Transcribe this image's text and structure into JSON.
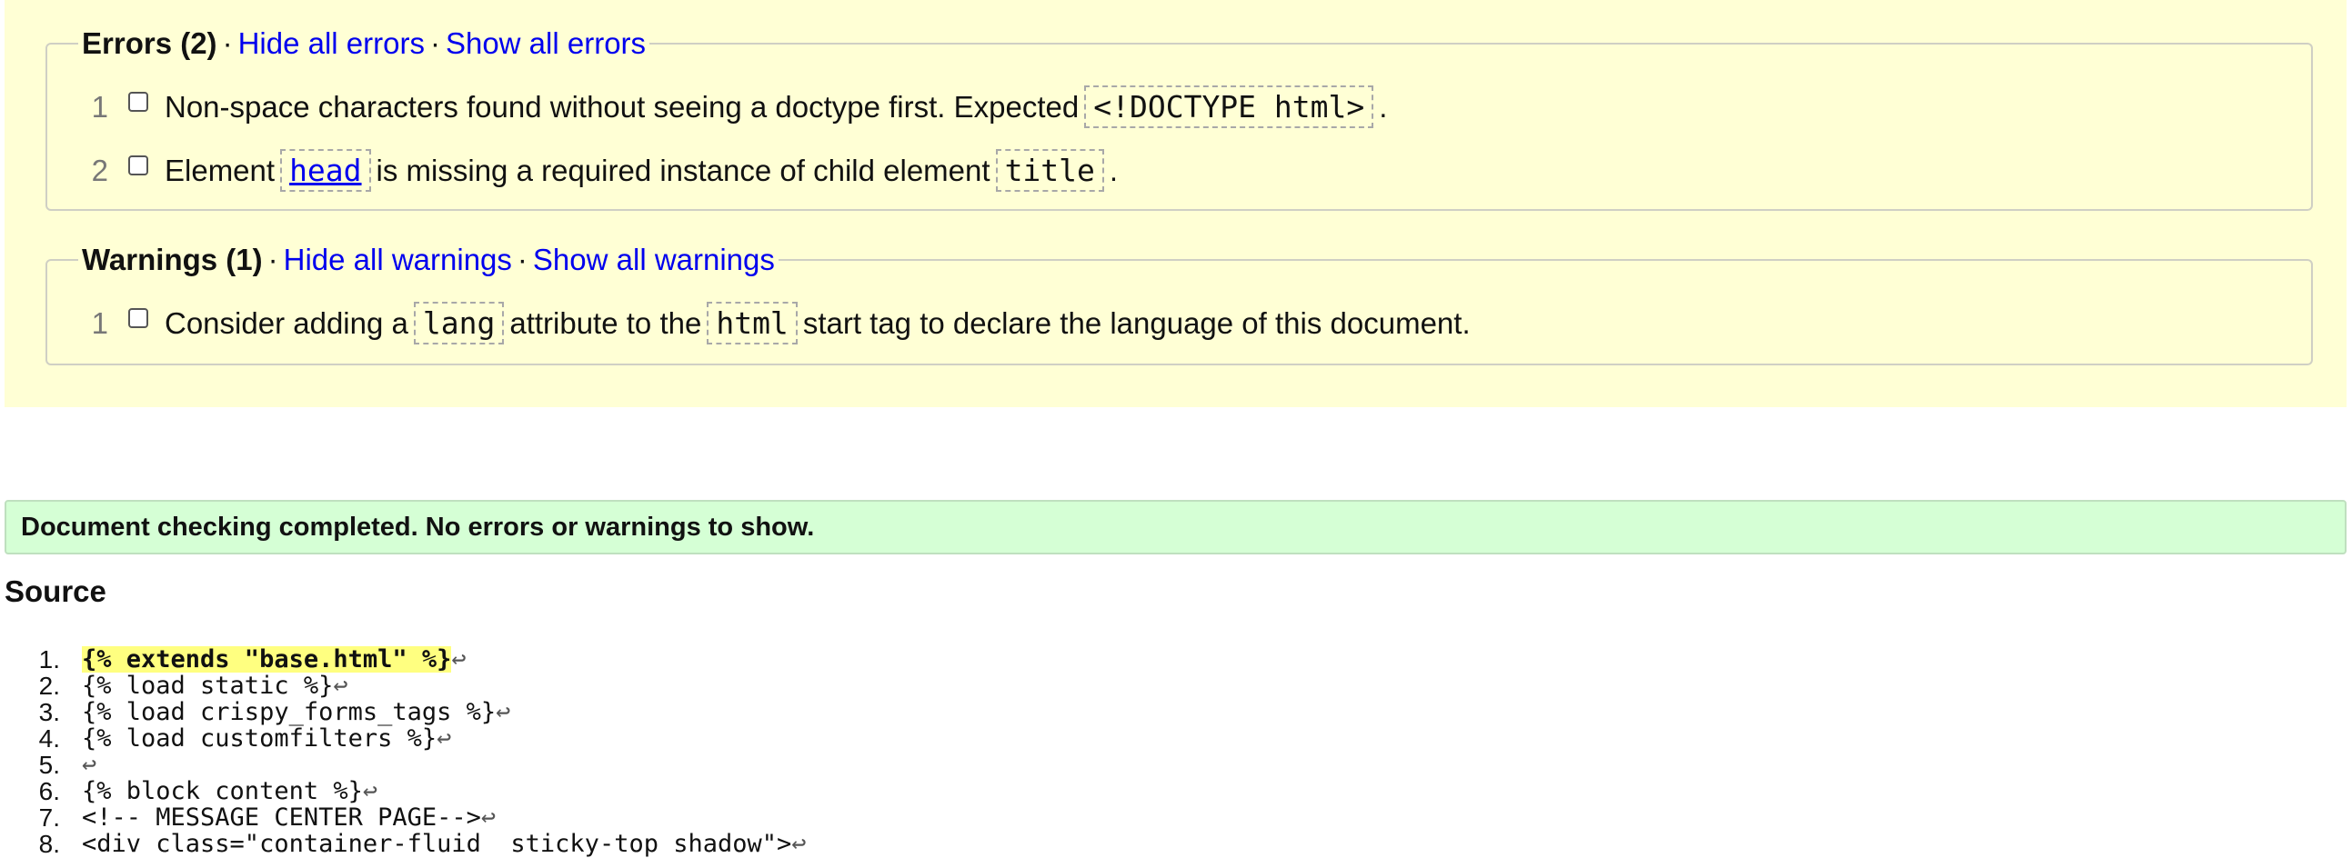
{
  "errors": {
    "heading": "Errors (2)",
    "separator": "·",
    "hide_label": "Hide all errors",
    "show_label": "Show all errors",
    "items": [
      {
        "num": "1",
        "text_before": "Non-space characters found without seeing a doctype first. Expected",
        "code": "<!DOCTYPE html>",
        "text_after": "."
      },
      {
        "num": "2",
        "text_before": "Element",
        "code": "head",
        "text_mid": "is missing a required instance of child element",
        "code2": "title",
        "text_after": "."
      }
    ]
  },
  "warnings": {
    "heading": "Warnings (1)",
    "separator": "·",
    "hide_label": "Hide all warnings",
    "show_label": "Show all warnings",
    "items": [
      {
        "num": "1",
        "text_before": "Consider adding a",
        "code": "lang",
        "text_mid": "attribute to the",
        "code2": "html",
        "text_after": "start tag to declare the language of this document."
      }
    ]
  },
  "success_message": "Document checking completed. No errors or warnings to show.",
  "source": {
    "title": "Source",
    "return_glyph": "↩",
    "lines": [
      {
        "num": "1.",
        "text": "{% extends \"base.html\" %}"
      },
      {
        "num": "2.",
        "text": "{% load static %}"
      },
      {
        "num": "3.",
        "text": "{% load crispy_forms_tags %}"
      },
      {
        "num": "4.",
        "text": "{% load customfilters %}"
      },
      {
        "num": "5.",
        "text": ""
      },
      {
        "num": "6.",
        "text": "{% block content %}"
      },
      {
        "num": "7.",
        "text": "<!-- MESSAGE CENTER PAGE-->"
      },
      {
        "num": "8.",
        "text": "<div class=\"container-fluid  sticky-top shadow\">"
      }
    ]
  },
  "colors": {
    "panel_bg": "#ffffd5",
    "success_bg": "#d5ffd5",
    "link": "#0000ee",
    "highlight": "#ffff80"
  }
}
